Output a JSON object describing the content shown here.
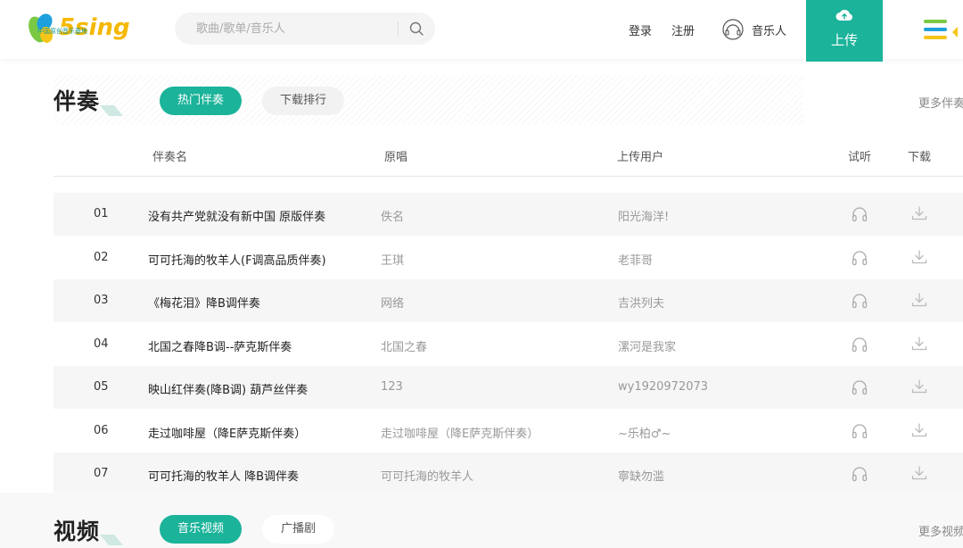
{
  "header": {
    "logo_text": "5sing",
    "logo_subtitle": "中国原创音乐基地",
    "search_placeholder": "歌曲/歌单/音乐人",
    "login": "登录",
    "register": "注册",
    "musician": "音乐人",
    "upload": "上传"
  },
  "accompaniment": {
    "title": "伴奏",
    "tabs": [
      {
        "label": "热门伴奏",
        "active": true
      },
      {
        "label": "下载排行",
        "active": false
      }
    ],
    "more": "更多伴奏",
    "columns": {
      "name": "伴奏名",
      "original": "原唱",
      "uploader": "上传用户",
      "listen": "试听",
      "download": "下载"
    },
    "rows": [
      {
        "num": "01",
        "name": "没有共产党就没有新中国 原版伴奏",
        "original": "佚名",
        "uploader": "阳光海洋!"
      },
      {
        "num": "02",
        "name": "可可托海的牧羊人(F调高品质伴奏)",
        "original": "王琪",
        "uploader": "老菲哥"
      },
      {
        "num": "03",
        "name": "《梅花泪》降B调伴奏",
        "original": "网络",
        "uploader": "吉洪列夫"
      },
      {
        "num": "04",
        "name": "北国之春降B调--萨克斯伴奏",
        "original": "北国之春",
        "uploader": "漯河是我家"
      },
      {
        "num": "05",
        "name": "映山红伴奏(降B调) 葫芦丝伴奏",
        "original": "123",
        "uploader": "wy1920972073"
      },
      {
        "num": "06",
        "name": "走过咖啡屋（降E萨克斯伴奏）",
        "original": "走过咖啡屋（降E萨克斯伴奏）",
        "uploader": "~乐柏♂~"
      },
      {
        "num": "07",
        "name": "可可托海的牧羊人 降B调伴奏",
        "original": "可可托海的牧羊人",
        "uploader": "寧缺勿滥"
      }
    ]
  },
  "video": {
    "title": "视频",
    "tabs": [
      {
        "label": "音乐视频",
        "active": true
      },
      {
        "label": "广播剧",
        "active": false
      }
    ],
    "more": "更多视频"
  },
  "colors": {
    "accent": "#1bb39a",
    "logo_yellow": "#f5c518",
    "logo_green": "#7ac943",
    "logo_blue": "#1ea0dc"
  }
}
